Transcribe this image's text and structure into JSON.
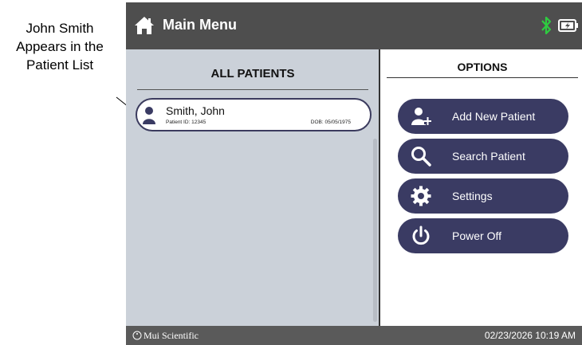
{
  "annotation": {
    "lines": [
      "John Smith",
      "Appears in the",
      "Patient List"
    ]
  },
  "header": {
    "title": "Main Menu",
    "icons": {
      "home": "home-icon",
      "bluetooth": "bluetooth-icon",
      "battery": "battery-icon"
    },
    "bluetooth_color": "#2ecc40"
  },
  "patients_panel": {
    "title": "ALL PATIENTS",
    "patients": [
      {
        "name": "Smith, John",
        "patient_id": "Patient ID: 12345",
        "dob": "DOB: 05/05/1975"
      }
    ]
  },
  "options_panel": {
    "title": "OPTIONS",
    "buttons": [
      {
        "label": "Add New Patient",
        "icon": "add-user-icon"
      },
      {
        "label": "Search Patient",
        "icon": "search-icon"
      },
      {
        "label": "Settings",
        "icon": "gear-icon"
      },
      {
        "label": "Power Off",
        "icon": "power-icon"
      }
    ]
  },
  "footer": {
    "brand": "Mui Scientific",
    "datetime": "02/23/2026 10:19 AM"
  },
  "colors": {
    "header_bg": "#4e4e4e",
    "list_bg": "#cbd1d9",
    "button_bg": "#3a3b63"
  }
}
